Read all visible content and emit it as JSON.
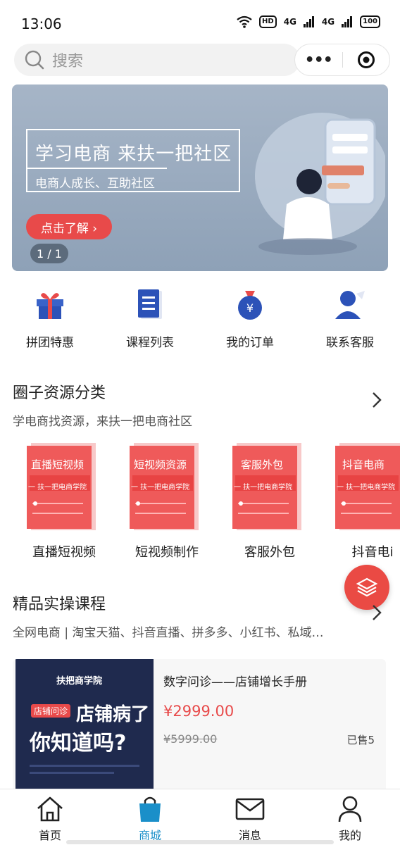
{
  "status": {
    "time": "13:06",
    "hd": "HD",
    "net1": "4G",
    "net2": "4G",
    "battery": "100"
  },
  "search": {
    "placeholder": "搜索"
  },
  "capsule": {
    "more": "•••"
  },
  "banner": {
    "title": "学习电商  来扶一把社区",
    "subtitle": "电商人成长、互助社区",
    "cta": "点击了解 ›",
    "pager": "1 / 1"
  },
  "quick": [
    {
      "label": "拼团特惠",
      "icon": "gift-icon"
    },
    {
      "label": "课程列表",
      "icon": "document-icon"
    },
    {
      "label": "我的订单",
      "icon": "money-bag-icon"
    },
    {
      "label": "联系客服",
      "icon": "user-service-icon"
    }
  ],
  "circle": {
    "title": "圈子资源分类",
    "desc": "学电商找资源，来扶一把电商社区"
  },
  "categories": [
    {
      "card": "直播短视频",
      "label": "直播短视频"
    },
    {
      "card": "短视频资源",
      "label": "短视频制作"
    },
    {
      "card": "客服外包",
      "label": "客服外包"
    },
    {
      "card": "抖音电商",
      "label": "抖音电i"
    }
  ],
  "card_sub": "一 扶一把电商学院",
  "course": {
    "title": "精品实操课程",
    "desc": "全网电商 | 淘宝天猫、抖音直播、拼多多、小红书、私域…"
  },
  "product": {
    "brand": "扶把商学院",
    "tag": "店铺问诊",
    "headline1": "店铺病了",
    "headline2": "你知道吗?",
    "name": "数字问诊——店铺增长手册",
    "price": "¥2999.00",
    "original": "¥5999.00",
    "sold": "已售5"
  },
  "tabs": [
    {
      "label": "首页"
    },
    {
      "label": "商城"
    },
    {
      "label": "消息"
    },
    {
      "label": "我的"
    }
  ],
  "colors": {
    "accent": "#e84a4a",
    "active_tab": "#1a8fc9"
  }
}
